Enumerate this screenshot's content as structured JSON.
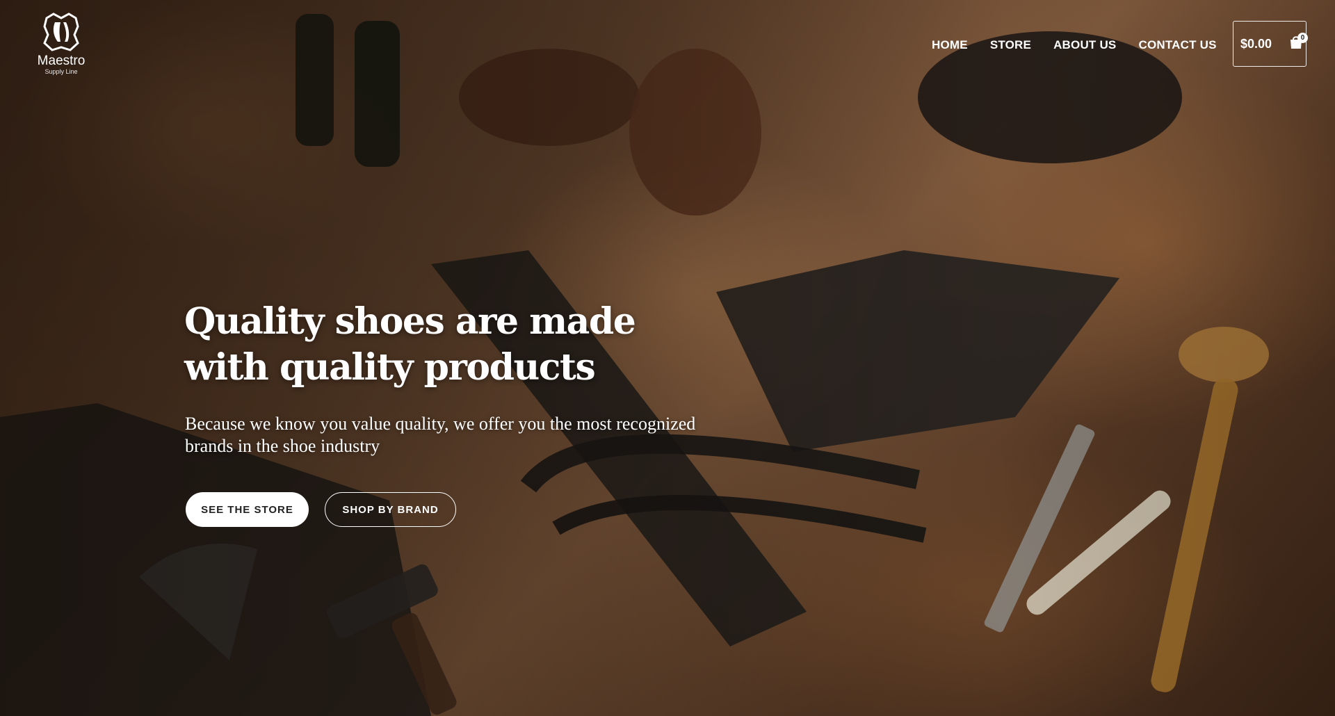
{
  "brand": {
    "name": "Maestro",
    "tagline": "Supply Line"
  },
  "nav": {
    "items": [
      "HOME",
      "STORE",
      "ABOUT US",
      "CONTACT US"
    ]
  },
  "cart": {
    "total": "$0.00",
    "count": "0",
    "icon": "shopping-bag-icon"
  },
  "hero": {
    "title": "Quality shoes are made with quality products",
    "subtitle": "Because we know you value quality, we offer you the most recognized brands in the shoe industry",
    "primary_button": "SEE THE STORE",
    "secondary_button": "SHOP BY BRAND"
  },
  "colors": {
    "primary_button_bg": "#ffffff",
    "text": "#ffffff"
  }
}
